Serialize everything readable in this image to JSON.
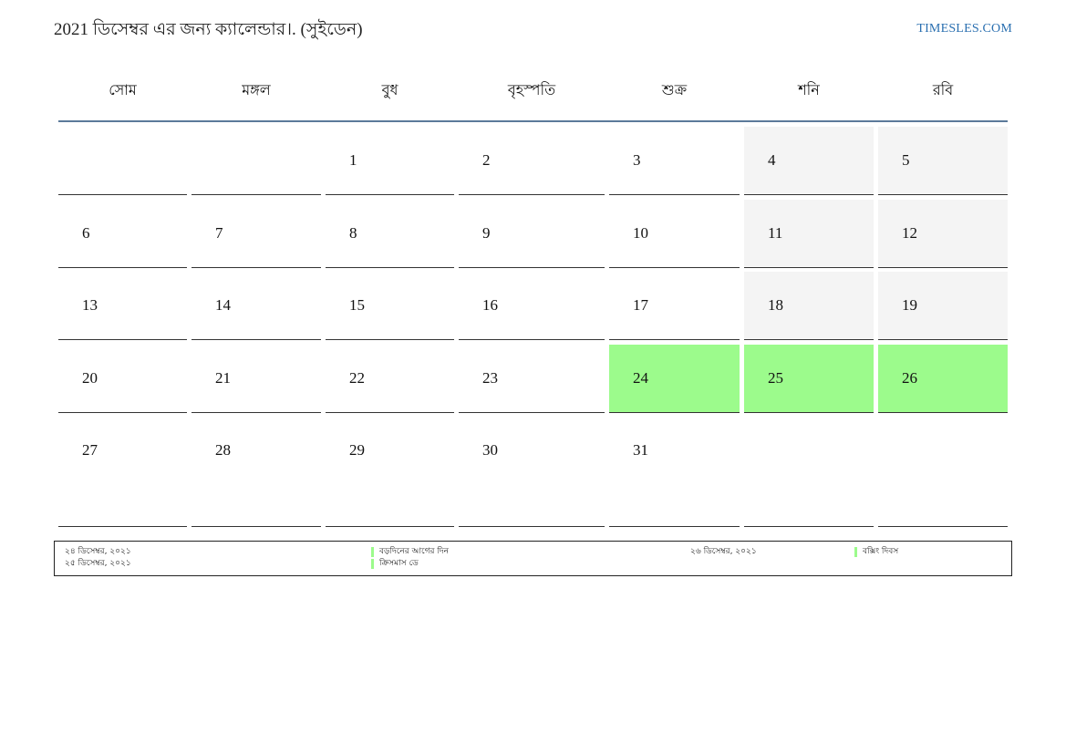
{
  "header": {
    "title": "2021 ডিসেম্বর এর জন্য ক্যালেন্ডার।. (সুইডেন)",
    "site": "TIMESLES.COM"
  },
  "weekdays": [
    "সোম",
    "মঙ্গল",
    "বুধ",
    "বৃহস্পতি",
    "শুক্র",
    "শনি",
    "রবি"
  ],
  "weeks": [
    [
      "",
      "",
      "1",
      "2",
      "3",
      "4",
      "5"
    ],
    [
      "6",
      "7",
      "8",
      "9",
      "10",
      "11",
      "12"
    ],
    [
      "13",
      "14",
      "15",
      "16",
      "17",
      "18",
      "19"
    ],
    [
      "20",
      "21",
      "22",
      "23",
      "24",
      "25",
      "26"
    ],
    [
      "27",
      "28",
      "29",
      "30",
      "31",
      "",
      ""
    ]
  ],
  "highlights": {
    "weekend_fill": "#f4f4f4",
    "holiday_fill": "#9cfb8c",
    "holidays": [
      "24",
      "25",
      "26"
    ]
  },
  "legend": [
    {
      "date": "২৪ ডিসেম্বর, ২০২১",
      "name": "বড়দিনের আগের দিন"
    },
    {
      "date": "২৫ ডিসেম্বর, ২০২১",
      "name": "ক্রিসমাস ডে"
    },
    {
      "date": "২৬ ডিসেম্বর, ২০২১",
      "name": "বক্সিং দিবস"
    }
  ]
}
